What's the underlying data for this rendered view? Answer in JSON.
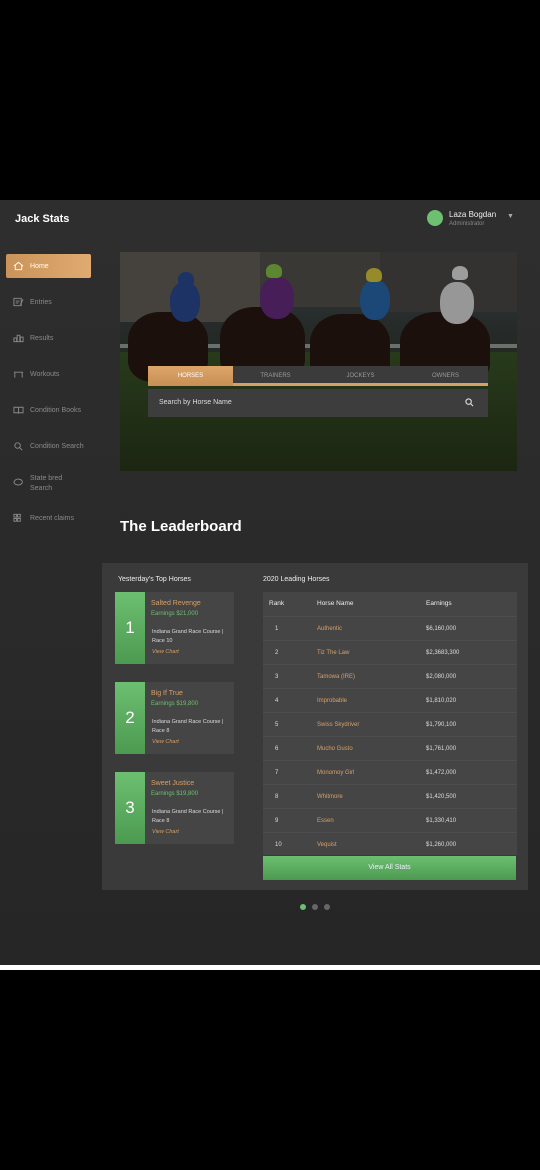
{
  "app": {
    "brand": "Jack Stats"
  },
  "user": {
    "name": "Laza Bogdan",
    "role": "Administrator"
  },
  "sidebar": {
    "items": [
      {
        "label": "Home",
        "icon": "home-icon",
        "active": true
      },
      {
        "label": "Entries",
        "icon": "entries-icon"
      },
      {
        "label": "Results",
        "icon": "results-icon"
      },
      {
        "label": "Workouts",
        "icon": "workouts-icon"
      },
      {
        "label": "Condition Books",
        "icon": "book-icon"
      },
      {
        "label": "Condition Search",
        "icon": "search-icon"
      },
      {
        "label": "State bred",
        "label2": "Search",
        "icon": "state-icon"
      },
      {
        "label": "Recent claims",
        "icon": "claims-icon"
      }
    ]
  },
  "search": {
    "tabs": [
      "HORSES",
      "TRAINERS",
      "JOCKEYS",
      "OWNERS"
    ],
    "active_tab": "HORSES",
    "placeholder": "Search by Horse Name"
  },
  "leaderboard": {
    "title": "The Leaderboard",
    "top_title": "Yesterday's Top Horses",
    "top_horses": [
      {
        "rank": "1",
        "name": "Salted Revenge",
        "earnings": "Earnings $21,000",
        "course": "Indiana Grand Race Course | Race 10",
        "link": "View Chart"
      },
      {
        "rank": "2",
        "name": "Big If True",
        "earnings": "Earnings $19,800",
        "course": "Indiana Grand Race Course | Race 8",
        "link": "View Chart"
      },
      {
        "rank": "3",
        "name": "Sweet Justice",
        "earnings": "Earnings $19,800",
        "course": "Indiana Grand Race Course | Race 8",
        "link": "View Chart"
      }
    ],
    "table_title": "2020 Leading Horses",
    "columns": [
      "Rank",
      "Horse Name",
      "Earnings"
    ],
    "rows": [
      {
        "rank": "1",
        "name": "Authentic",
        "earnings": "$6,160,000"
      },
      {
        "rank": "2",
        "name": "Tiz The Law",
        "earnings": "$2,3683,300"
      },
      {
        "rank": "3",
        "name": "Tamowa (IRE)",
        "earnings": "$2,080,000"
      },
      {
        "rank": "4",
        "name": "Improbable",
        "earnings": "$1,810,020"
      },
      {
        "rank": "5",
        "name": "Swiss Skydriver",
        "earnings": "$1,790,100"
      },
      {
        "rank": "6",
        "name": "Mucho Gusto",
        "earnings": "$1,761,000"
      },
      {
        "rank": "7",
        "name": "Monomoy Girl",
        "earnings": "$1,472,000"
      },
      {
        "rank": "8",
        "name": "Whitmore",
        "earnings": "$1,420,500"
      },
      {
        "rank": "9",
        "name": "Essen",
        "earnings": "$1,330,410"
      },
      {
        "rank": "10",
        "name": "Vequist",
        "earnings": "$1,260,000"
      }
    ],
    "view_all": "View All Stats"
  },
  "colors": {
    "accent": "#d7a066",
    "green": "#6cc070",
    "background": "#2a2a2a"
  }
}
